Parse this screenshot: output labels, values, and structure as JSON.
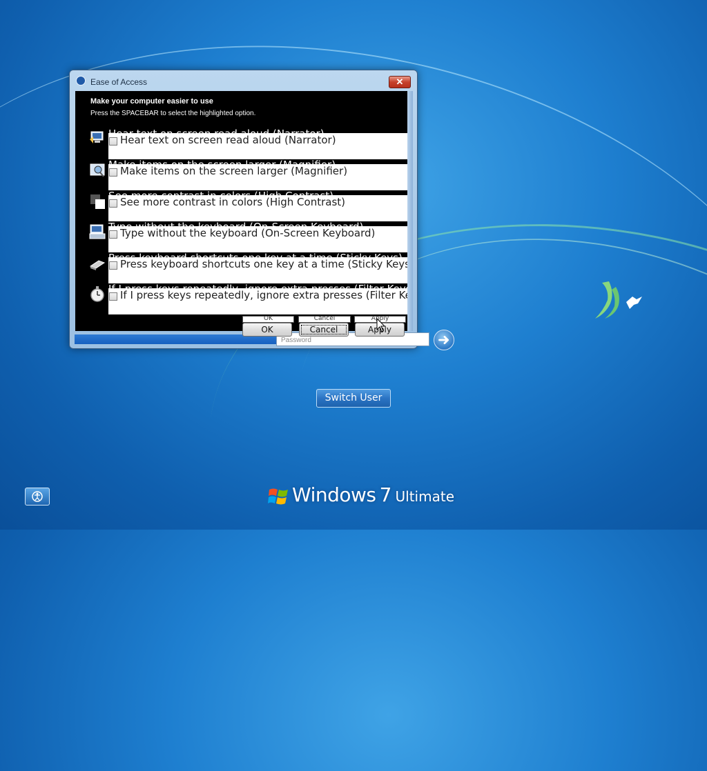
{
  "dialog": {
    "title": "Ease of Access",
    "close_label": "✕",
    "heading": "Make your computer easier to use",
    "subheading": "Press the SPACEBAR to select the highlighted option.",
    "options": [
      {
        "label": "Hear text on screen read aloud (Narrator)",
        "icon": "narrator-icon",
        "checked": false
      },
      {
        "label": "Make items on the screen larger (Magnifier)",
        "icon": "magnifier-icon",
        "checked": false
      },
      {
        "label": "See more contrast in colors (High Contrast)",
        "icon": "high-contrast-icon",
        "checked": false
      },
      {
        "label": "Type without the keyboard (On-Screen Keyboard)",
        "icon": "keyboard-icon",
        "checked": false
      },
      {
        "label": "Press keyboard shortcuts one key at a time (Sticky Keys)",
        "icon": "sticky-keys-icon",
        "checked": false
      },
      {
        "label": "If I press keys repeatedly, ignore extra presses (Filter Keys)",
        "icon": "stopwatch-icon",
        "checked": false
      }
    ],
    "buttons": {
      "ok": "OK",
      "cancel": "Cancel",
      "apply": "Apply"
    }
  },
  "logon": {
    "password_placeholder": "Password",
    "switch_user": "Switch User"
  },
  "branding": {
    "windows": "Windows",
    "version": "7",
    "edition": "Ultimate"
  },
  "colors": {
    "desktop": "#1e7fd0",
    "dialog_frame": "#9cc0e2",
    "content_bg": "#000000",
    "close_button": "#c6412c"
  }
}
